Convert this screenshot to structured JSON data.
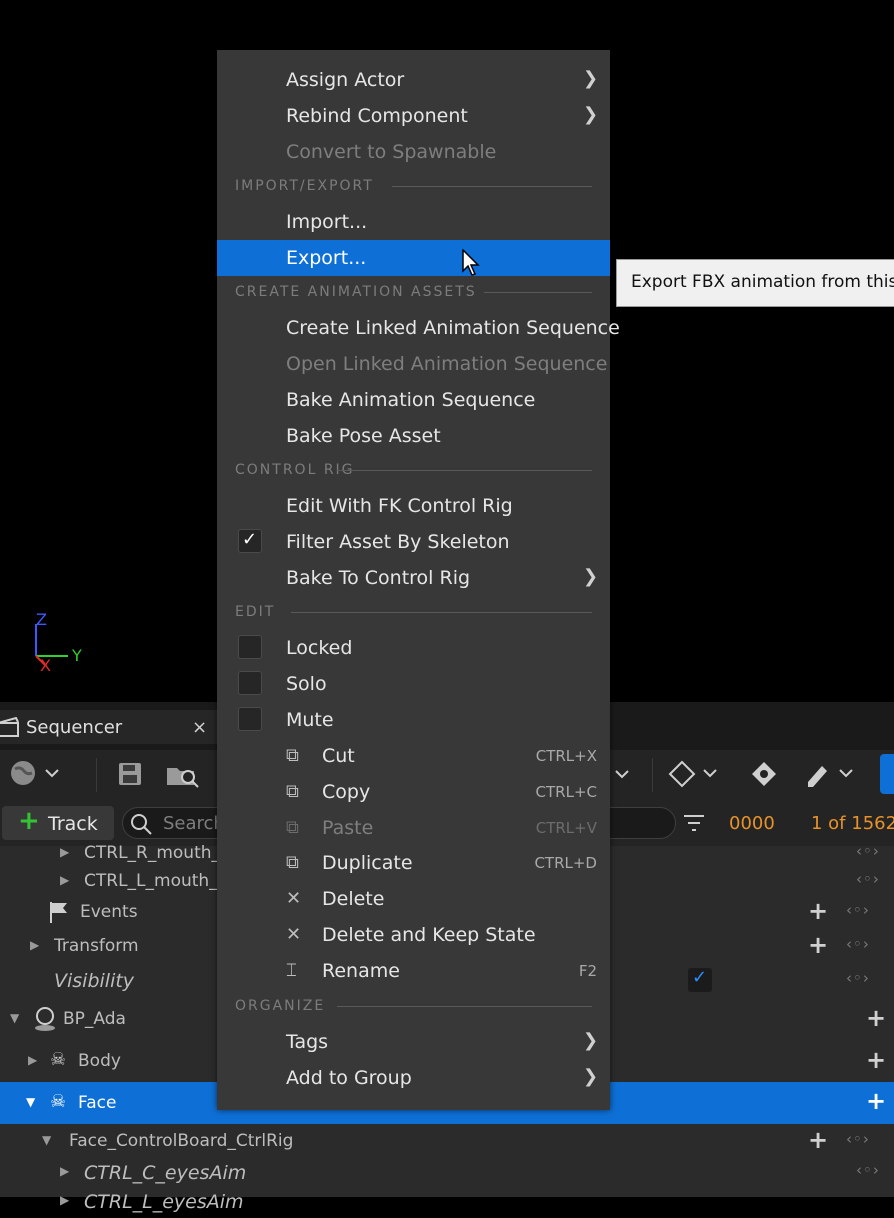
{
  "viewport": {
    "axis_z": "Z",
    "axis_y": "Y",
    "axis_x": "X"
  },
  "sequencer": {
    "tab_title": "Sequencer",
    "close": "×",
    "track_button": "Track",
    "search_placeholder": "Search",
    "frame": "0000",
    "frame_count": "1 of 1562"
  },
  "tree": [
    {
      "label": "CTRL_R_mouth_t",
      "indent": 84,
      "italic": false
    },
    {
      "label": "CTRL_L_mouth_t",
      "indent": 84,
      "italic": false
    },
    {
      "label": "Events",
      "indent": 80,
      "italic": false
    },
    {
      "label": "Transform",
      "indent": 54,
      "italic": false
    },
    {
      "label": "Visibility",
      "indent": 54,
      "italic": true
    },
    {
      "label": "BP_Ada",
      "indent": 63,
      "italic": false
    },
    {
      "label": "Body",
      "indent": 78,
      "italic": false
    },
    {
      "label": "Face",
      "indent": 78,
      "italic": false
    },
    {
      "label": "Face_ControlBoard_CtrlRig",
      "indent": 69,
      "italic": false
    },
    {
      "label": "CTRL_C_eyesAim",
      "indent": 84,
      "italic": true
    },
    {
      "label": "CTRL_L_eyesAim",
      "indent": 84,
      "italic": true
    }
  ],
  "menu": {
    "assign_actor": "Assign Actor",
    "rebind_component": "Rebind Component",
    "convert_spawnable": "Convert to Spawnable",
    "sect_import_export": "IMPORT/EXPORT",
    "import": "Import...",
    "export": "Export...",
    "sect_anim_assets": "CREATE ANIMATION ASSETS",
    "create_linked": "Create Linked Animation Sequence",
    "open_linked": "Open Linked Animation Sequence",
    "bake_anim": "Bake Animation Sequence",
    "bake_pose": "Bake Pose Asset",
    "sect_control_rig": "CONTROL RIG",
    "edit_fk": "Edit With FK Control Rig",
    "filter_skeleton": "Filter Asset By Skeleton",
    "bake_control_rig": "Bake To Control Rig",
    "sect_edit": "EDIT",
    "locked": "Locked",
    "solo": "Solo",
    "mute": "Mute",
    "cut": "Cut",
    "cut_sc": "CTRL+X",
    "copy": "Copy",
    "copy_sc": "CTRL+C",
    "paste": "Paste",
    "paste_sc": "CTRL+V",
    "duplicate": "Duplicate",
    "duplicate_sc": "CTRL+D",
    "delete": "Delete",
    "delete_keep": "Delete and Keep State",
    "rename": "Rename",
    "rename_sc": "F2",
    "sect_organize": "ORGANIZE",
    "tags": "Tags",
    "add_group": "Add to Group"
  },
  "tooltip": "Export FBX animation from this o",
  "colors": {
    "accent": "#0e6fd6",
    "menu_bg": "#383838",
    "frame_orange": "#e8922a"
  }
}
